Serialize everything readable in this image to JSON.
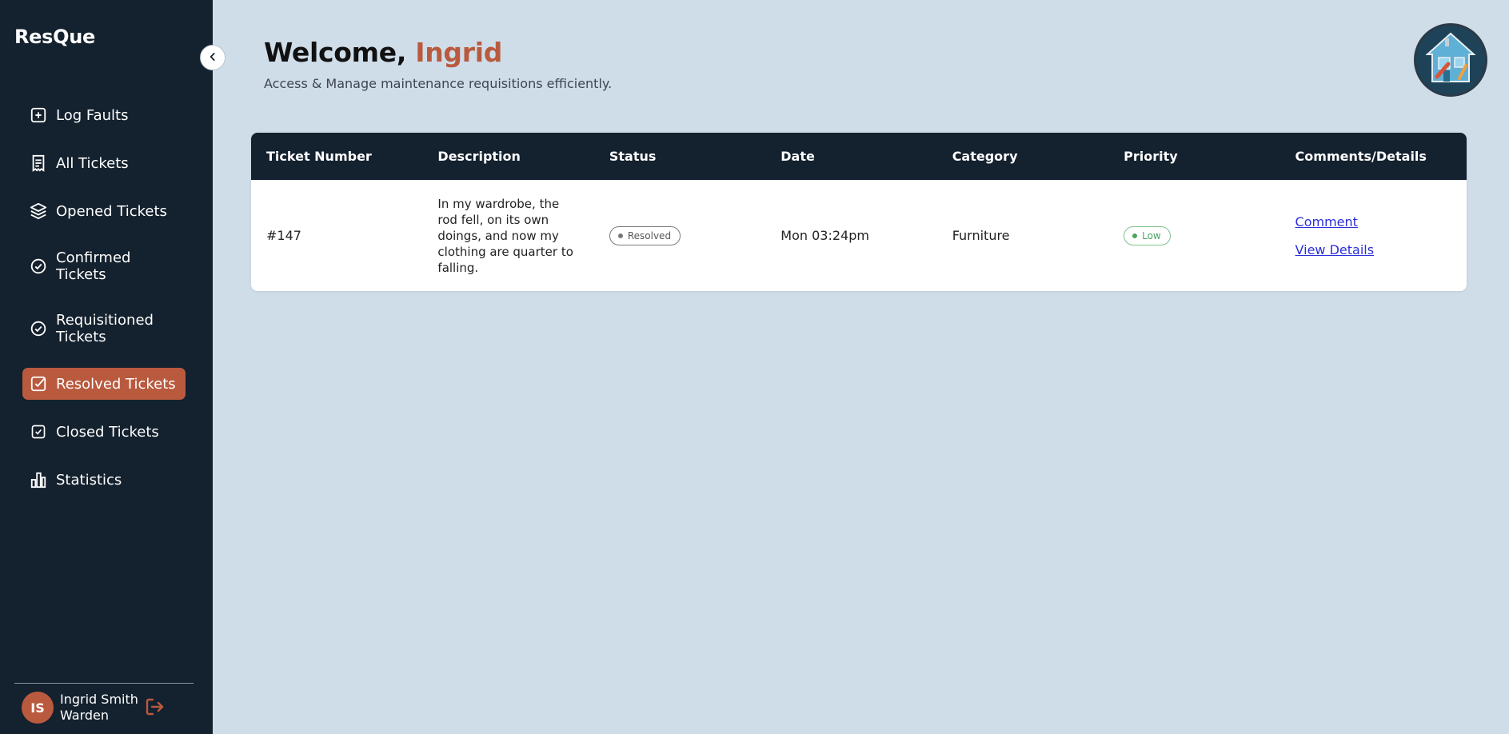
{
  "app": {
    "brand": "ResQue"
  },
  "sidebar": {
    "items": [
      {
        "label": "Log Faults",
        "icon": "plus-square-icon",
        "active": false
      },
      {
        "label": "All Tickets",
        "icon": "receipt-icon",
        "active": false
      },
      {
        "label": "Opened Tickets",
        "icon": "layers-icon",
        "active": false
      },
      {
        "label": "Confirmed Tickets",
        "icon": "check-circle-icon",
        "active": false
      },
      {
        "label": "Requisitioned Tickets",
        "icon": "check-circle-icon",
        "active": false
      },
      {
        "label": "Resolved Tickets",
        "icon": "check-square-icon",
        "active": true
      },
      {
        "label": "Closed Tickets",
        "icon": "check-square-icon",
        "active": false
      },
      {
        "label": "Statistics",
        "icon": "bar-chart-icon",
        "active": false
      }
    ],
    "user": {
      "initials": "IS",
      "name": "Ingrid Smith",
      "role": "Warden"
    }
  },
  "header": {
    "welcome_prefix": "Welcome,",
    "user_first_name": "Ingrid",
    "subtitle": "Access & Manage maintenance requisitions efficiently."
  },
  "table": {
    "columns": [
      "Ticket Number",
      "Description",
      "Status",
      "Date",
      "Category",
      "Priority",
      "Comments/Details"
    ],
    "rows": [
      {
        "ticket_number": "#147",
        "description": "In my wardrobe, the rod fell, on its own doings, and now my clothing are quarter to falling.",
        "status": "Resolved",
        "date": "Mon 03:24pm",
        "category": "Furniture",
        "priority": "Low",
        "comment_link": "Comment",
        "details_link": "View Details"
      }
    ]
  },
  "colors": {
    "sidebar_bg": "#14212e",
    "accent": "#b95a3e",
    "page_bg": "#cfdde9",
    "link": "#2b2fd9",
    "priority_low": "#4aa660"
  }
}
